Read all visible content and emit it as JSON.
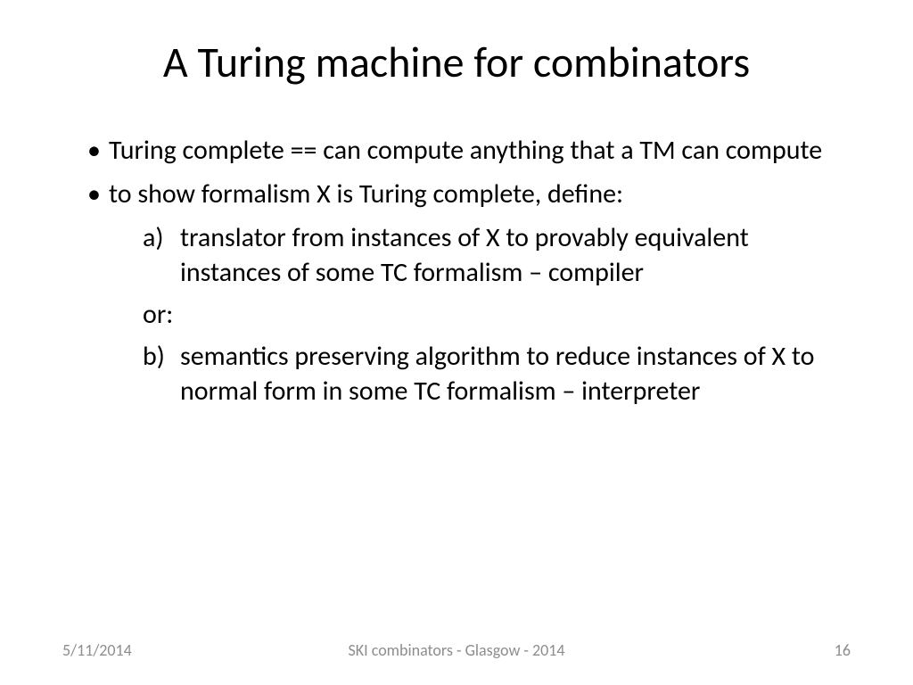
{
  "title": "A Turing machine for combinators",
  "bullets": [
    "Turing complete == can compute anything that a TM can compute",
    "to show formalism X is Turing complete, define:"
  ],
  "subItems": {
    "a_marker": "a)",
    "a_text": "translator from instances of X to provably equivalent instances of some TC formalism – compiler",
    "or_text": "or:",
    "b_marker": "b)",
    "b_text": "semantics preserving algorithm to reduce instances of X to normal form in some TC formalism – interpreter"
  },
  "footer": {
    "date": "5/11/2014",
    "center": "SKI combinators - Glasgow - 2014",
    "page": "16"
  }
}
